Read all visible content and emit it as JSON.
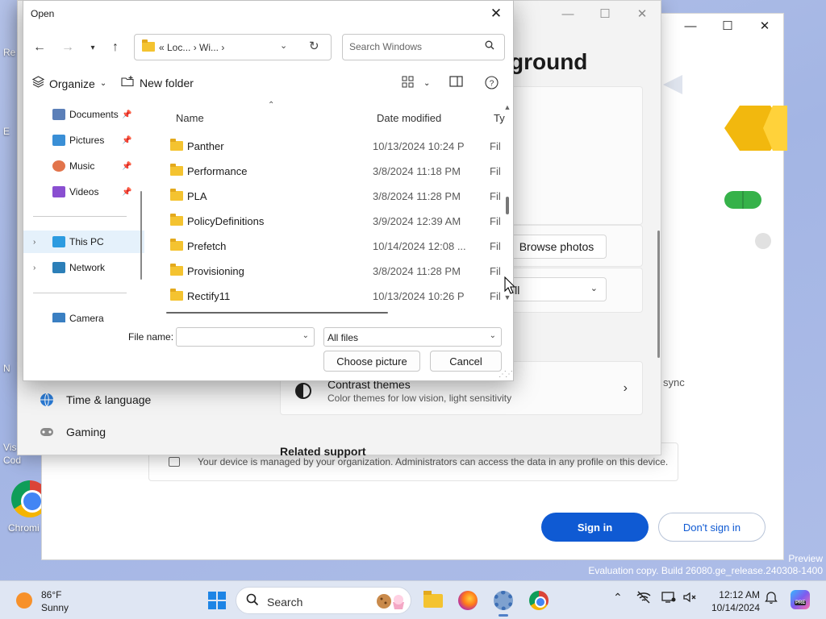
{
  "desktop": {
    "fragments": [
      "Re",
      "E",
      "N",
      "Vis",
      "Cod"
    ],
    "chrome_label": "Chromi"
  },
  "signin_window": {
    "managed_text": "Your device is managed by your organization. Administrators can access the data in any profile on this device.",
    "sign_in": "Sign in",
    "dont_sign_in": "Don't sign in"
  },
  "settings_window": {
    "heading_fragment": "ground",
    "browse_photos": "Browse photos",
    "fill_fragment": "ill",
    "contrast_title": "Contrast themes",
    "contrast_sub": "Color themes for low vision, light sensitivity",
    "sync_fragment": "sync",
    "nav": [
      {
        "label": "Time & language",
        "icon": "globe-clock-icon"
      },
      {
        "label": "Gaming",
        "icon": "gamepad-icon"
      }
    ],
    "related_support": "Related support"
  },
  "dialog": {
    "title": "Open",
    "breadcrumb": "« Loc... › Wi... ›",
    "search_placeholder": "Search Windows",
    "organize": "Organize",
    "new_folder": "New folder",
    "nav_pane": [
      {
        "label": "Documents",
        "pinned": true,
        "icon_color": "#5b7fb8"
      },
      {
        "label": "Pictures",
        "pinned": true,
        "icon_color": "#3a8fd6"
      },
      {
        "label": "Music",
        "pinned": true,
        "icon_color": "#e2744b"
      },
      {
        "label": "Videos",
        "pinned": true,
        "icon_color": "#8a4fd1"
      },
      {
        "label": "This PC",
        "pinned": false,
        "icon_color": "#2c9be0"
      },
      {
        "label": "Network",
        "pinned": false,
        "icon_color": "#2c7fb8"
      },
      {
        "label": "Camera",
        "pinned": false,
        "icon_color": "#3a7fc2"
      }
    ],
    "columns": {
      "name": "Name",
      "date": "Date modified",
      "type": "Ty"
    },
    "files": [
      {
        "name": "Panther",
        "date": "10/13/2024 10:24 P",
        "type": "Fil"
      },
      {
        "name": "Performance",
        "date": "3/8/2024 11:18 PM",
        "type": "Fil"
      },
      {
        "name": "PLA",
        "date": "3/8/2024 11:28 PM",
        "type": "Fil"
      },
      {
        "name": "PolicyDefinitions",
        "date": "3/9/2024 12:39 AM",
        "type": "Fil"
      },
      {
        "name": "Prefetch",
        "date": "10/14/2024 12:08 ...",
        "type": "Fil"
      },
      {
        "name": "Provisioning",
        "date": "3/8/2024 11:28 PM",
        "type": "Fil"
      },
      {
        "name": "Rectify11",
        "date": "10/13/2024 10:26 P",
        "type": "Fil"
      }
    ],
    "file_name_label": "File name:",
    "file_name_value": "",
    "file_type": "All files",
    "choose_button": "Choose picture",
    "cancel_button": "Cancel"
  },
  "watermark": {
    "line1": "Preview",
    "line2": "Evaluation copy. Build 26080.ge_release.240308-1400"
  },
  "taskbar": {
    "temperature": "86°F",
    "condition": "Sunny",
    "search_label": "Search",
    "time": "12:12 AM",
    "date": "10/14/2024",
    "copilot_badge": "PRE"
  }
}
